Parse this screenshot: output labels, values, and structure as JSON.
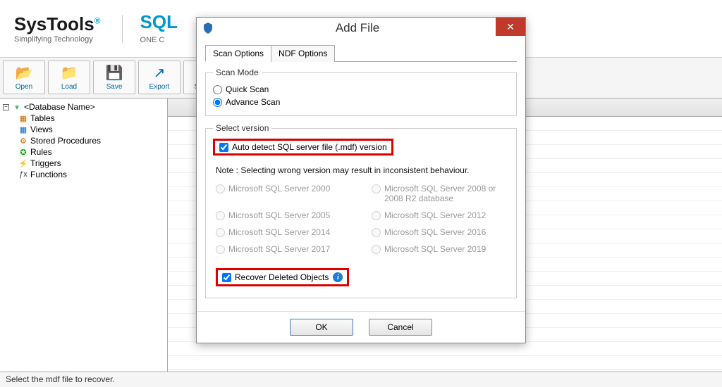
{
  "header": {
    "brand": "SysTools",
    "reg": "®",
    "brand_sub": "Simplifying Technology",
    "product": "SQL",
    "product_sub": "ONE C"
  },
  "toolbar": {
    "open": "Open",
    "load": "Load",
    "save": "Save",
    "export": "Export",
    "support": "Suppo"
  },
  "tree": {
    "root": "<Database Name>",
    "items": [
      {
        "label": "Tables"
      },
      {
        "label": "Views"
      },
      {
        "label": "Stored Procedures"
      },
      {
        "label": "Rules"
      },
      {
        "label": "Triggers"
      },
      {
        "label": "Functions"
      }
    ]
  },
  "dialog": {
    "title": "Add File",
    "tabs": {
      "scan": "Scan Options",
      "ndf": "NDF Options"
    },
    "scan_mode": {
      "legend": "Scan Mode",
      "quick": "Quick Scan",
      "advance": "Advance Scan"
    },
    "select_version": {
      "legend": "Select version",
      "auto_detect": "Auto detect SQL server file (.mdf) version",
      "note": "Note : Selecting wrong version may result in inconsistent behaviour.",
      "versions": [
        "Microsoft SQL Server 2000",
        "Microsoft SQL Server 2008 or 2008 R2 database",
        "Microsoft SQL Server 2005",
        "Microsoft SQL Server 2012",
        "Microsoft SQL Server 2014",
        "Microsoft SQL Server 2016",
        "Microsoft SQL Server 2017",
        "Microsoft SQL Server 2019"
      ],
      "recover": "Recover Deleted Objects"
    },
    "buttons": {
      "ok": "OK",
      "cancel": "Cancel"
    }
  },
  "status": "Select the mdf file to recover."
}
